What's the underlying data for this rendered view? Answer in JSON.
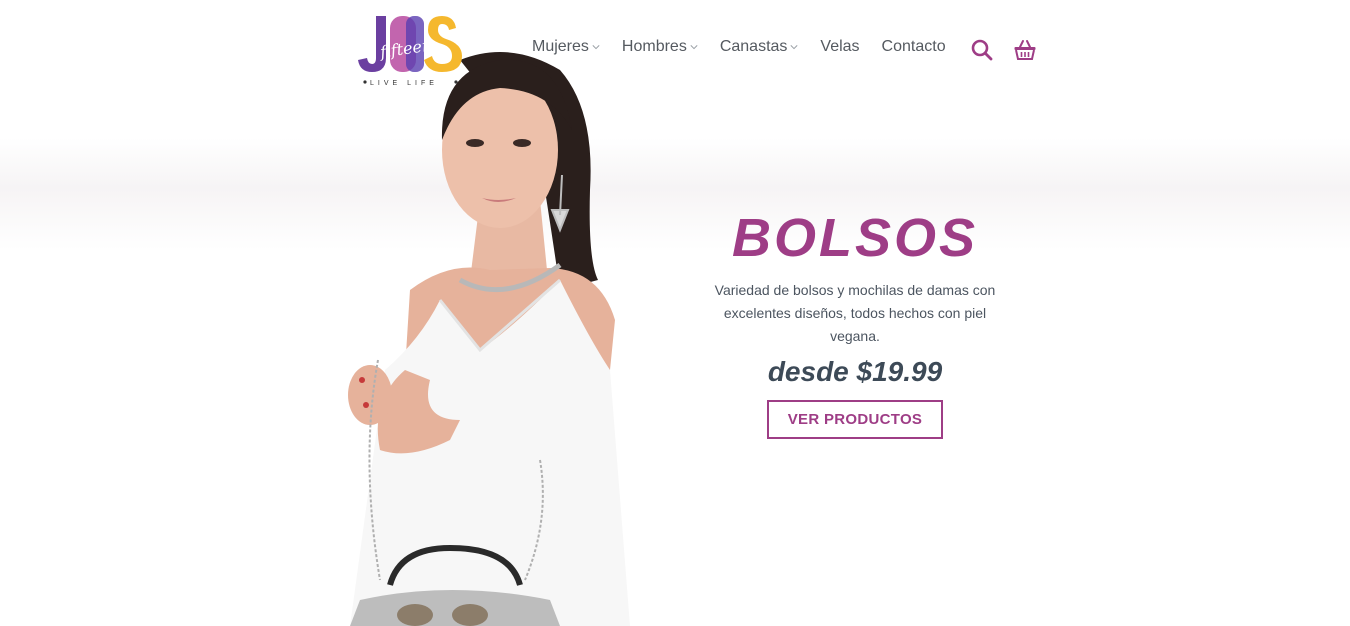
{
  "brand": {
    "logo_text": "JOS fifteen",
    "tagline": "LIVE LIFE",
    "colors": {
      "purple": "#6b3fa0",
      "magenta": "#9e3d86",
      "yellow": "#f5b82e"
    }
  },
  "nav": {
    "items": [
      {
        "label": "Mujeres",
        "has_dropdown": true
      },
      {
        "label": "Hombres",
        "has_dropdown": true
      },
      {
        "label": "Canastas",
        "has_dropdown": true
      },
      {
        "label": "Velas",
        "has_dropdown": false
      },
      {
        "label": "Contacto",
        "has_dropdown": false
      }
    ],
    "icons": [
      "search-icon",
      "basket-icon"
    ],
    "icon_color": "#9e3d86"
  },
  "hero": {
    "title": "BOLSOS",
    "description": "Variedad de bolsos y mochilas de damas con excelentes diseños, todos hechos con piel vegana.",
    "price": "desde $19.99",
    "button_label": "VER PRODUCTOS",
    "accent_color": "#9e3d86"
  }
}
